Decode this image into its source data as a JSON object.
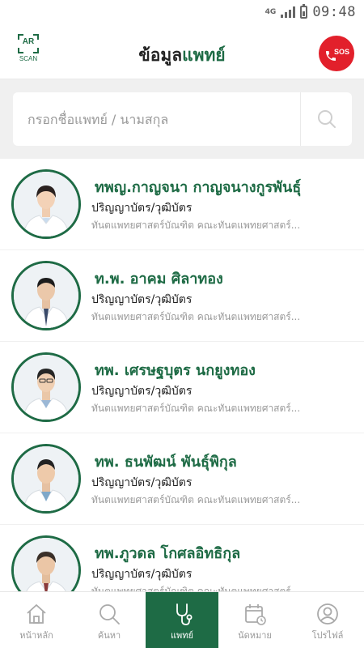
{
  "status_bar": {
    "network": "4G",
    "time": "09:48"
  },
  "header": {
    "ar_label": "AR",
    "scan_label": "SCAN",
    "title_part1": "ข้อมูล",
    "title_part2": "แพทย์",
    "sos_label": "SOS"
  },
  "search": {
    "placeholder": "กรอกชื่อแพทย์ / นามสกุล",
    "value": ""
  },
  "doctors": [
    {
      "name": "ทพญ.กาญจนา  กาญจนางกูรพันธุ์",
      "degree": "ปริญญาบัตร/วุฒิบัตร",
      "education": "ทันตแพทยศาสตร์บัณฑิต คณะทันตแพทยศาสตร์..."
    },
    {
      "name": "ท.พ. อาคม  ศิลาทอง",
      "degree": "ปริญญาบัตร/วุฒิบัตร",
      "education": "ทันตแพทยศาสตร์บัณฑิต คณะทันตแพทยศาสตร์..."
    },
    {
      "name": "ทพ. เศรษฐบุตร  นกยูงทอง",
      "degree": "ปริญญาบัตร/วุฒิบัตร",
      "education": "ทันตแพทยศาสตร์บัณฑิต คณะทันตแพทยศาสตร์..."
    },
    {
      "name": "ทพ. ธนพัฒน์  พันธุ์พิกุล",
      "degree": "ปริญญาบัตร/วุฒิบัตร",
      "education": "ทันตแพทยศาสตร์บัณฑิต คณะทันตแพทยศาสตร์..."
    },
    {
      "name": "ทพ.ภูวดล โกศลอิทธิกุล",
      "degree": "ปริญญาบัตร/วุฒิบัตร",
      "education": "ทันตแพทยศาสตร์บัณฑิต คณะทันตแพทยศาสตร์..."
    }
  ],
  "nav": {
    "items": [
      {
        "label": "หน้าหลัก",
        "icon": "home-icon"
      },
      {
        "label": "ค้นหา",
        "icon": "search-icon"
      },
      {
        "label": "แพทย์",
        "icon": "stethoscope-icon",
        "active": true
      },
      {
        "label": "นัดหมาย",
        "icon": "calendar-icon"
      },
      {
        "label": "โปรไฟล์",
        "icon": "profile-icon"
      }
    ]
  },
  "colors": {
    "brand_green": "#1e6b45",
    "sos_red": "#e2202b",
    "inactive": "#999999",
    "background": "#f0f0f0"
  }
}
